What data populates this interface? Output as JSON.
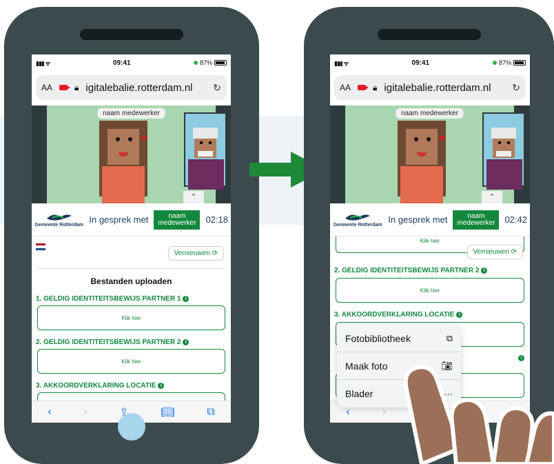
{
  "status": {
    "time": "09:41",
    "battery": "87%"
  },
  "browser": {
    "text_size_label": "AA",
    "url": "igitalebalie.rotterdam.nl"
  },
  "video": {
    "name_chip": "naam medewerker"
  },
  "call": {
    "logo_text": "Gemeente Rotterdam",
    "in_gesprek_label": "In gesprek met",
    "colleague_line1": "naam",
    "colleague_line2": "medewerker",
    "timer_left": "02:18",
    "timer_right": "02:42"
  },
  "page": {
    "refresh_label": "Vernieuwen",
    "section_title": "Bestanden uploaden",
    "requirement_1": "1. GELDIG IDENTITEITSBEWIJS PARTNER 1",
    "requirement_2": "2. GELDIG IDENTITEITSBEWIJS PARTNER 2",
    "requirement_3": "3. AKKOORDVERKLARING LOCATIE",
    "upload_button": "Klik hier",
    "info_glyph": "i"
  },
  "sheet": {
    "items": [
      {
        "label": "Fotobibliotheek",
        "icon": "photo-library-icon"
      },
      {
        "label": "Maak foto",
        "icon": "camera-icon"
      },
      {
        "label": "Blader",
        "icon": "more-icon"
      }
    ]
  },
  "colors": {
    "green": "#13883d",
    "phone": "#3b4a4c",
    "home_button": "#a7d5ec",
    "hand": "#9c7058"
  }
}
